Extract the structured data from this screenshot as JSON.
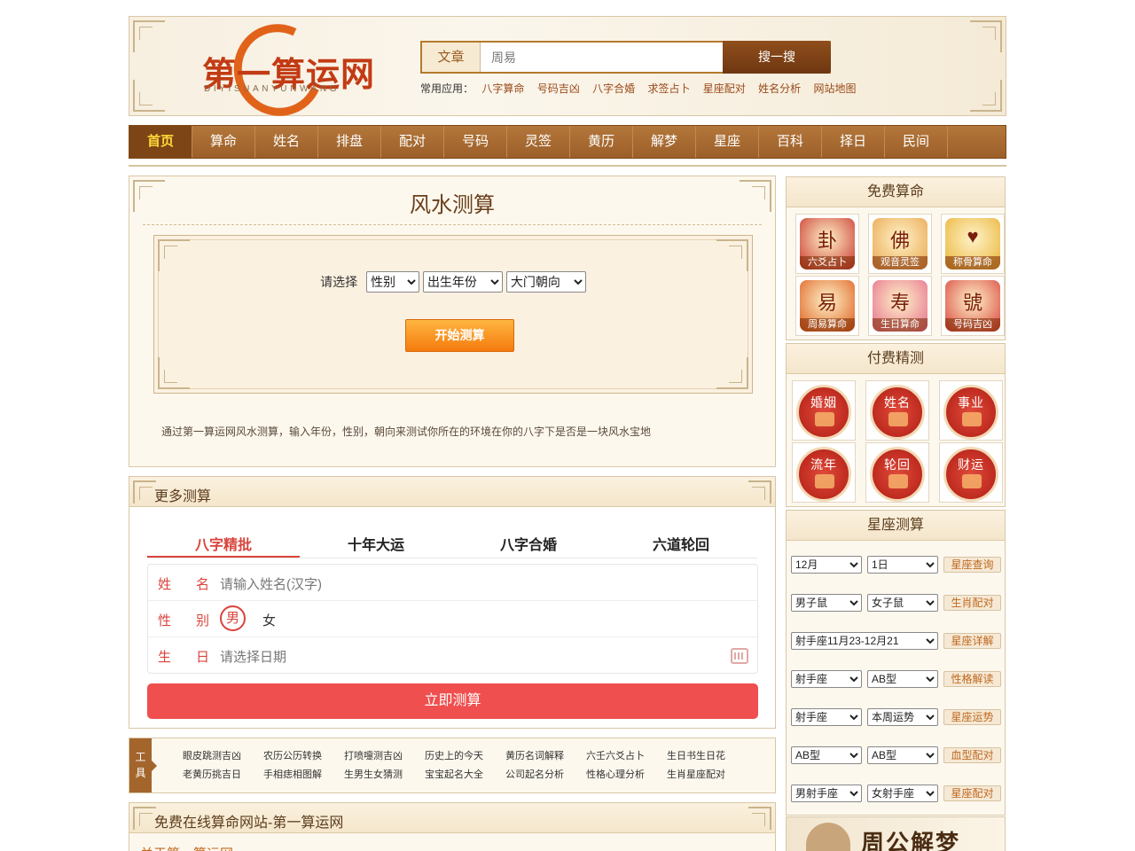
{
  "header": {
    "logo_text": "第一算运网",
    "logo_sub": "DIYISUANYUNWANG",
    "search": {
      "category": "文章",
      "value": "周易",
      "button": "搜一搜"
    },
    "common_label": "常用应用：",
    "common_links": [
      "八字算命",
      "号码吉凶",
      "八字合婚",
      "求签占卜",
      "星座配对",
      "姓名分析",
      "网站地图"
    ]
  },
  "nav": [
    "首页",
    "算命",
    "姓名",
    "排盘",
    "配对",
    "号码",
    "灵签",
    "黄历",
    "解梦",
    "星座",
    "百科",
    "择日",
    "民间"
  ],
  "fengshui": {
    "title": "风水测算",
    "choose_label": "请选择",
    "selects": [
      "性别",
      "出生年份",
      "大门朝向"
    ],
    "start_button": "开始测算",
    "description": "通过第一算运网风水测算，输入年份，性别，朝向来测试你所在的环境在你的八字下是否是一块风水宝地"
  },
  "more": {
    "title": "更多测算",
    "tabs": [
      "八字精批",
      "十年大运",
      "八字合婚",
      "六道轮回"
    ],
    "name_label": "姓名",
    "name_placeholder": "请输入姓名(汉字)",
    "gender_label": "性别",
    "male": "男",
    "female": "女",
    "birth_label": "生日",
    "birth_placeholder": "请选择日期",
    "submit": "立即测算"
  },
  "tools": {
    "label": "工具",
    "row1": [
      "眼皮跳测吉凶",
      "农历公历转换",
      "打喷嚏测吉凶",
      "历史上的今天",
      "黄历名词解释",
      "六壬六爻占卜",
      "生日书生日花"
    ],
    "row2": [
      "老黄历挑吉日",
      "手相痣相图解",
      "生男生女猜测",
      "宝宝起名大全",
      "公司起名分析",
      "性格心理分析",
      "生肖星座配对"
    ]
  },
  "about": {
    "title": "免费在线算命网站-第一算运网",
    "link": "关于第一算运网"
  },
  "sidebar": {
    "free_title": "免费算命",
    "free_apps": [
      {
        "label": "六爻占卜",
        "glyph": "卦",
        "color": "#c8322a"
      },
      {
        "label": "观音灵签",
        "glyph": "佛",
        "color": "#e8a34a"
      },
      {
        "label": "称骨算命",
        "glyph": "♥",
        "color": "#e9b233"
      },
      {
        "label": "周易算命",
        "glyph": "易",
        "color": "#dd5a1a"
      },
      {
        "label": "生日算命",
        "glyph": "寿",
        "color": "#e56a8a"
      },
      {
        "label": "号码吉凶",
        "glyph": "號",
        "color": "#d8403a"
      }
    ],
    "paid_title": "付费精测",
    "paid_items": [
      "婚姻",
      "姓名",
      "事业",
      "流年",
      "轮回",
      "财运"
    ],
    "zodiac_title": "星座测算",
    "zodiac_rows": [
      {
        "s1": "12月",
        "s2": "1日",
        "btn": "星座查询"
      },
      {
        "s1": "男子鼠",
        "s2": "女子鼠",
        "btn": "生肖配对"
      },
      {
        "s1": "射手座11月23-12月21",
        "s2": "",
        "btn": "星座详解"
      },
      {
        "s1": "射手座",
        "s2": "AB型",
        "btn": "性格解读"
      },
      {
        "s1": "射手座",
        "s2": "本周运势",
        "btn": "星座运势"
      },
      {
        "s1": "AB型",
        "s2": "AB型",
        "btn": "血型配对"
      },
      {
        "s1": "男射手座",
        "s2": "女射手座",
        "btn": "星座配对"
      }
    ],
    "zhougong": "周公解梦"
  }
}
